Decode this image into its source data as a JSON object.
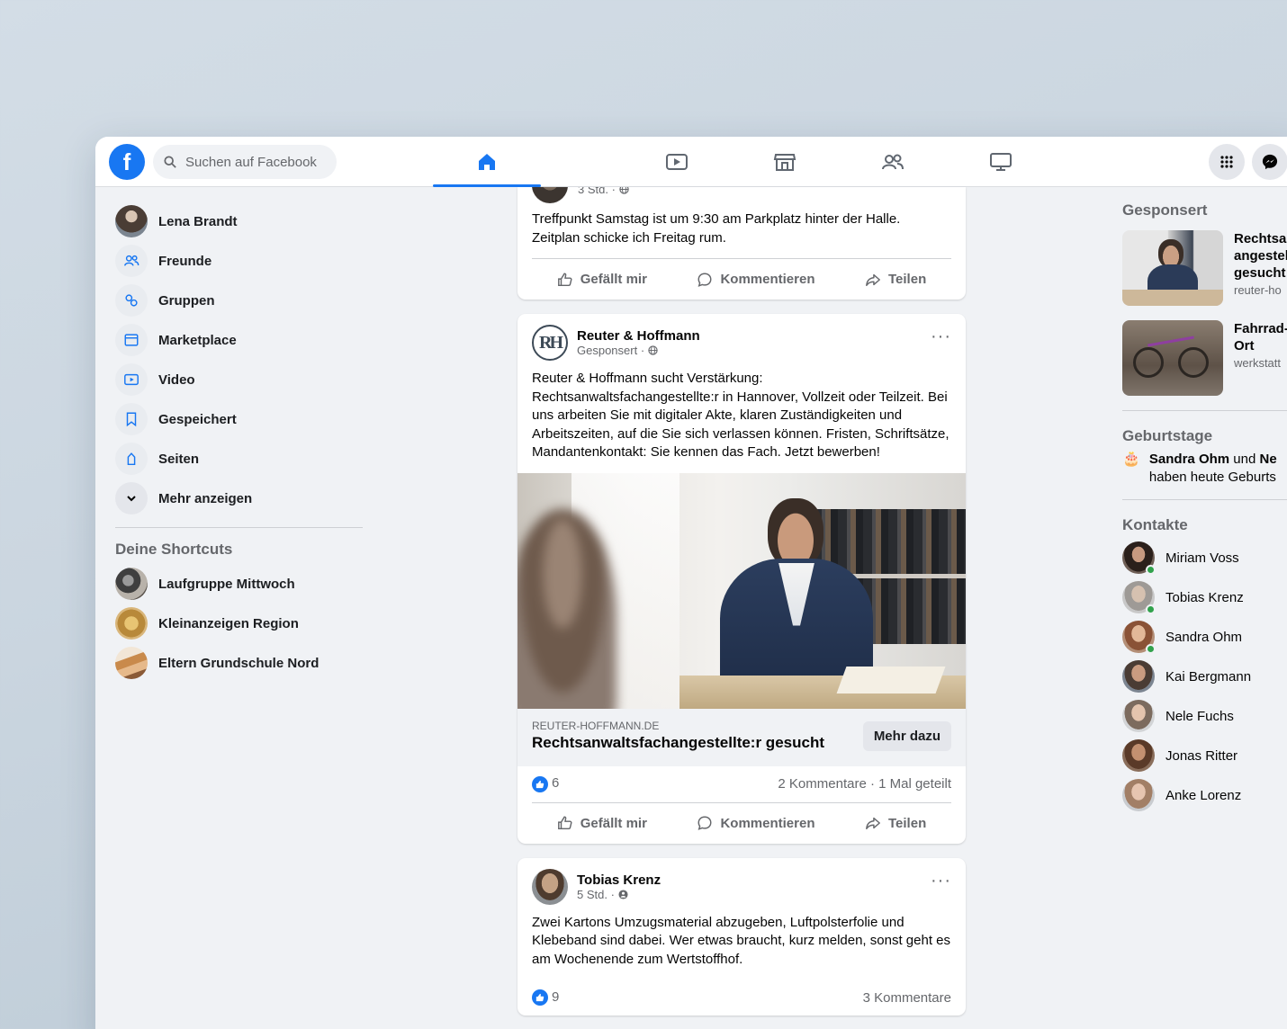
{
  "topbar": {
    "logo": "f",
    "search_placeholder": "Suchen auf Facebook",
    "tabs": [
      "home-icon",
      "video-icon",
      "marketplace-icon",
      "groups-icon",
      "gaming-icon"
    ],
    "active_tab": "home-icon"
  },
  "left": {
    "profile": "Lena Brandt",
    "items": [
      {
        "label": "Freunde",
        "icon": "friends-icon"
      },
      {
        "label": "Gruppen",
        "icon": "groups-icon"
      },
      {
        "label": "Marketplace",
        "icon": "marketplace-icon"
      },
      {
        "label": "Video",
        "icon": "video-icon"
      },
      {
        "label": "Gespeichert",
        "icon": "bookmark-icon"
      },
      {
        "label": "Seiten",
        "icon": "flag-icon"
      },
      {
        "label": "Mehr anzeigen",
        "icon": "chevron-down-icon"
      }
    ],
    "shortcuts_title": "Deine Shortcuts",
    "shortcuts": [
      "Laufgruppe Mittwoch",
      "Kleinanzeigen Region",
      "Eltern Grundschule Nord"
    ]
  },
  "feed": {
    "post1": {
      "meta": "3 Std. ·",
      "text": "Treffpunkt Samstag ist um 9:30 am Parkplatz hinter der Halle. Zeitplan schicke ich Freitag rum."
    },
    "ad": {
      "author": "Reuter & Hoffmann",
      "avatar_text": "RH",
      "meta": "Gesponsert ·",
      "text": "Reuter & Hoffmann sucht Verstärkung: Rechtsanwaltsfachangestellte:r in Hannover, Vollzeit oder Teilzeit. Bei uns arbeiten Sie mit digitaler Akte, klaren Zuständigkeiten und Arbeitszeiten, auf die Sie sich verlassen können. Fristen, Schriftsätze, Mandantenkontakt: Sie kennen das Fach. Jetzt bewerben!",
      "domain": "REUTER-HOFFMANN.DE",
      "link_title": "Rechtsanwaltsfachangestellte:r gesucht",
      "cta": "Mehr dazu",
      "likes": "6",
      "stats": "2 Kommentare · 1 Mal geteilt"
    },
    "post3": {
      "author": "Tobias Krenz",
      "meta": "5 Std. ·",
      "text": "Zwei Kartons Umzugsmaterial abzugeben, Luftpolsterfolie und Klebeband sind dabei. Wer etwas braucht, kurz melden, sonst geht es am Wochenende zum Wertstoffhof.",
      "likes": "9",
      "stats": "3 Kommentare"
    },
    "actions": {
      "like": "Gefällt mir",
      "comment": "Kommentieren",
      "share": "Teilen"
    }
  },
  "right": {
    "sponsored_title": "Gesponsert",
    "sponsored": [
      {
        "title_lines": [
          "Rechtsan",
          "angestel",
          "gesucht"
        ],
        "domain": "reuter-ho"
      },
      {
        "title_lines": [
          "Fahrrad-",
          "Ort"
        ],
        "domain": "werkstatt"
      }
    ],
    "birthdays_title": "Geburtstage",
    "birthday_name1": "Sandra Ohm",
    "birthday_and": " und ",
    "birthday_name2": "Ne",
    "birthday_line2": "haben heute Geburts",
    "contacts_title": "Kontakte",
    "contacts": [
      {
        "name": "Miriam Voss",
        "online": true
      },
      {
        "name": "Tobias Krenz",
        "online": true
      },
      {
        "name": "Sandra Ohm",
        "online": true
      },
      {
        "name": "Kai Bergmann",
        "online": false
      },
      {
        "name": "Nele Fuchs",
        "online": false
      },
      {
        "name": "Jonas Ritter",
        "online": false
      },
      {
        "name": "Anke Lorenz",
        "online": false
      }
    ]
  },
  "colors": {
    "brand": "#1877f2",
    "online": "#31a24c"
  }
}
